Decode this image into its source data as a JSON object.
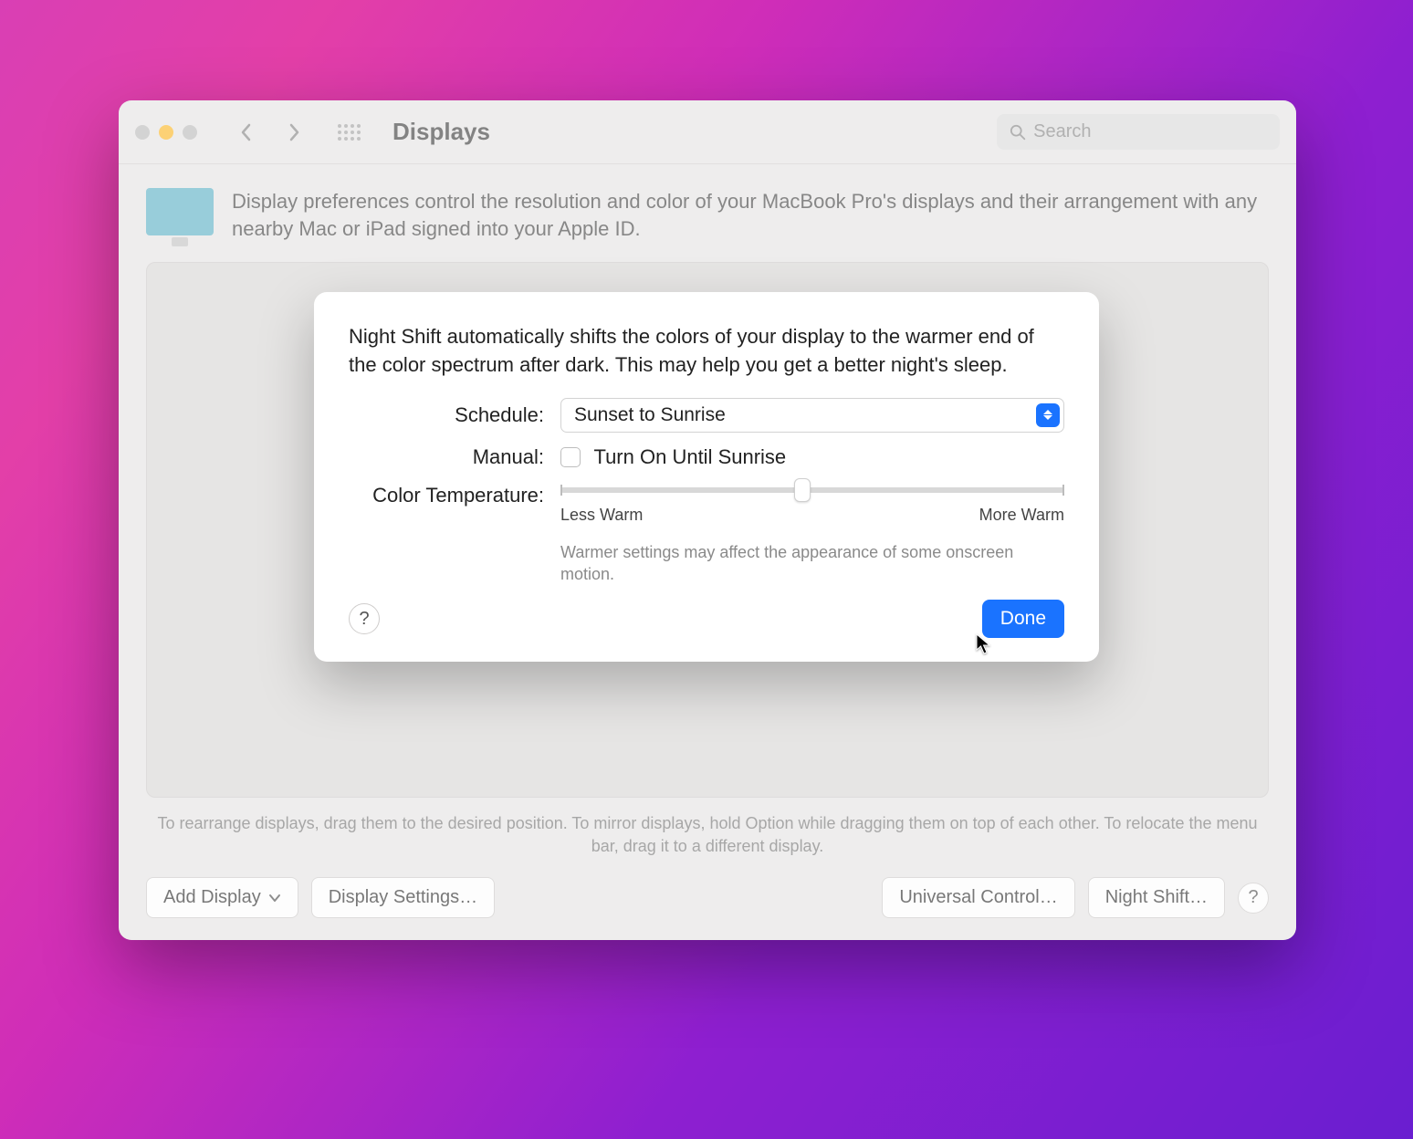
{
  "window": {
    "title": "Displays",
    "search_placeholder": "Search",
    "description": "Display preferences control the resolution and color of your MacBook Pro's displays and their arrangement with any nearby Mac or iPad signed into your Apple ID.",
    "hint": "To rearrange displays, drag them to the desired position. To mirror displays, hold Option while dragging them on top of each other. To relocate the menu bar, drag it to a different display."
  },
  "footer": {
    "add_display": "Add Display",
    "display_settings": "Display Settings…",
    "universal_control": "Universal Control…",
    "night_shift": "Night Shift…",
    "help": "?"
  },
  "modal": {
    "description": "Night Shift automatically shifts the colors of your display to the warmer end of the color spectrum after dark. This may help you get a better night's sleep.",
    "schedule_label": "Schedule:",
    "schedule_value": "Sunset to Sunrise",
    "manual_label": "Manual:",
    "manual_checkbox_label": "Turn On Until Sunrise",
    "manual_checked": false,
    "color_temp_label": "Color Temperature:",
    "slider": {
      "min_label": "Less Warm",
      "max_label": "More Warm",
      "value_percent": 48
    },
    "slider_note": "Warmer settings may affect the appearance of some onscreen motion.",
    "help": "?",
    "done": "Done"
  },
  "colors": {
    "accent": "#1a73ff"
  }
}
